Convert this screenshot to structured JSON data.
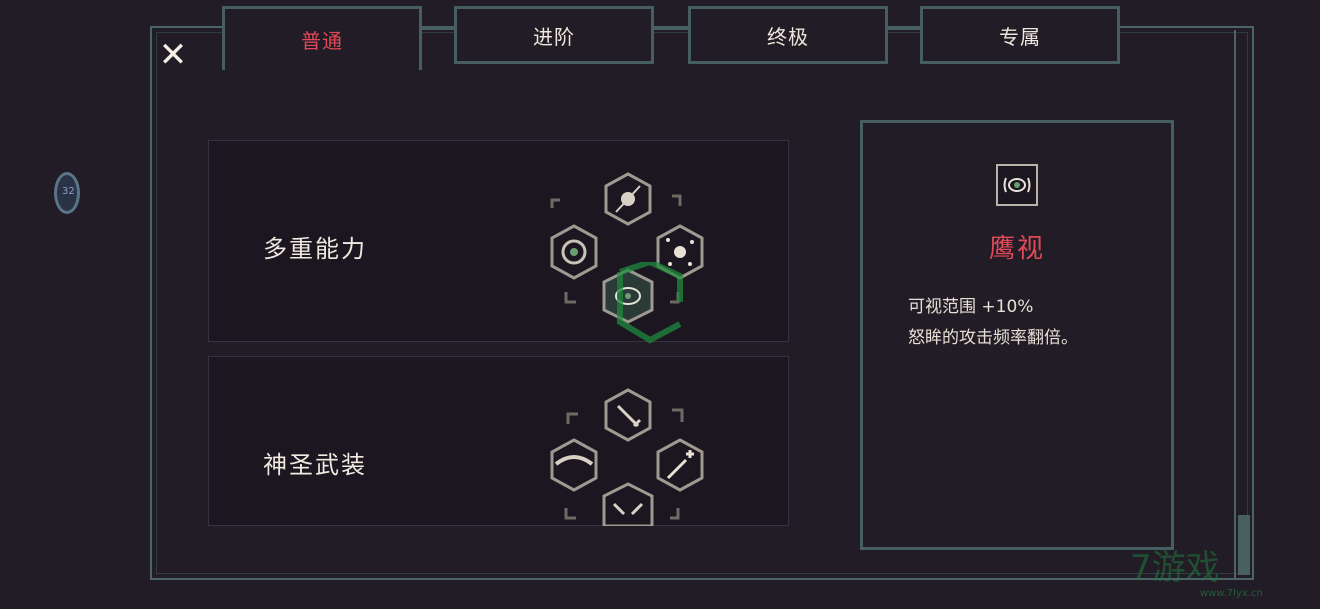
{
  "tabs": [
    {
      "label": "普通",
      "active": true
    },
    {
      "label": "进阶",
      "active": false
    },
    {
      "label": "终极",
      "active": false
    },
    {
      "label": "专属",
      "active": false
    }
  ],
  "close_icon": "close-icon",
  "panels": [
    {
      "title": "多重能力"
    },
    {
      "title": "神圣武装"
    }
  ],
  "detail": {
    "title": "鹰视",
    "line1": "可视范围 +10%",
    "line2": "怒眸的攻击频率翻倍。"
  },
  "watermark": {
    "text": "7游戏",
    "url": "www.7lyx.cn"
  },
  "colors": {
    "accent": "#e04a58",
    "frame": "#465e62",
    "background": "#221c26"
  }
}
